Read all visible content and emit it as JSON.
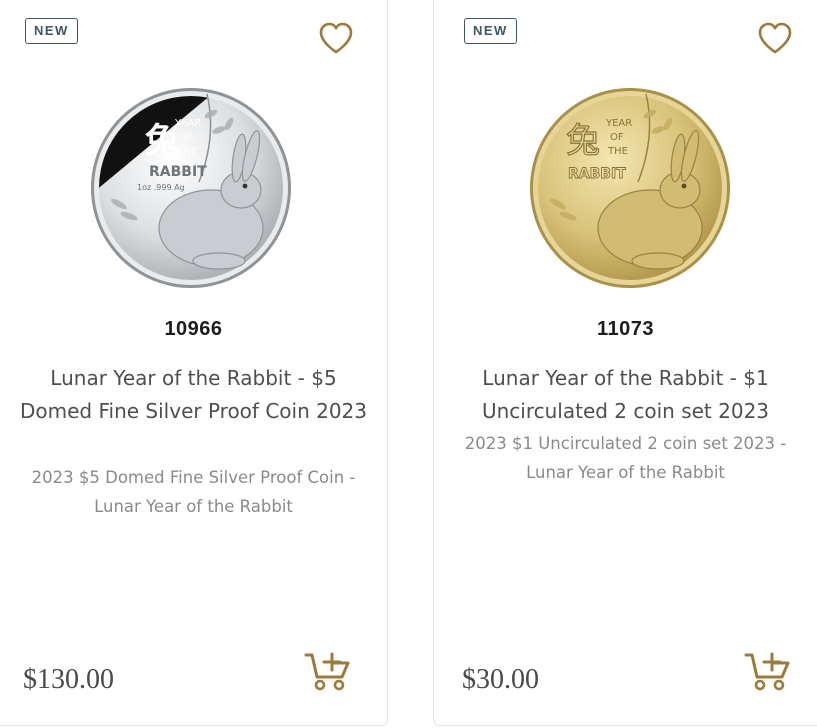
{
  "products": [
    {
      "badge": "NEW",
      "sku": "10966",
      "title": "Lunar Year of the Rabbit - $5 Domed Fine Silver Proof Coin 2023",
      "description": "2023 $5 Domed Fine Silver Proof Coin - Lunar Year of the Rabbit",
      "price": "$130.00",
      "coin_lettering": [
        "兔",
        "YEAR",
        "OF",
        "THE",
        "RABBIT",
        "1oz .999 Ag"
      ],
      "coin_color": "#d6d8da"
    },
    {
      "badge": "NEW",
      "sku": "11073",
      "title": "Lunar Year of the Rabbit - $1 Uncirculated 2 coin set 2023",
      "description": "2023 $1 Uncirculated 2 coin set 2023 - Lunar Year of the Rabbit",
      "price": "$30.00",
      "coin_lettering": [
        "兔",
        "YEAR",
        "OF",
        "THE",
        "RABBIT"
      ],
      "coin_color": "#d9c37a"
    }
  ],
  "icons": {
    "wishlist": "heart-outline-icon",
    "cart": "add-to-cart-icon"
  },
  "colors": {
    "accent_gold": "#9c7a3c",
    "badge_text": "#3f5663",
    "sku_text": "#1d1d1d",
    "title_text": "#4f4f4f",
    "desc_text": "#8a8a8a",
    "price_text": "#4a4a4a"
  }
}
